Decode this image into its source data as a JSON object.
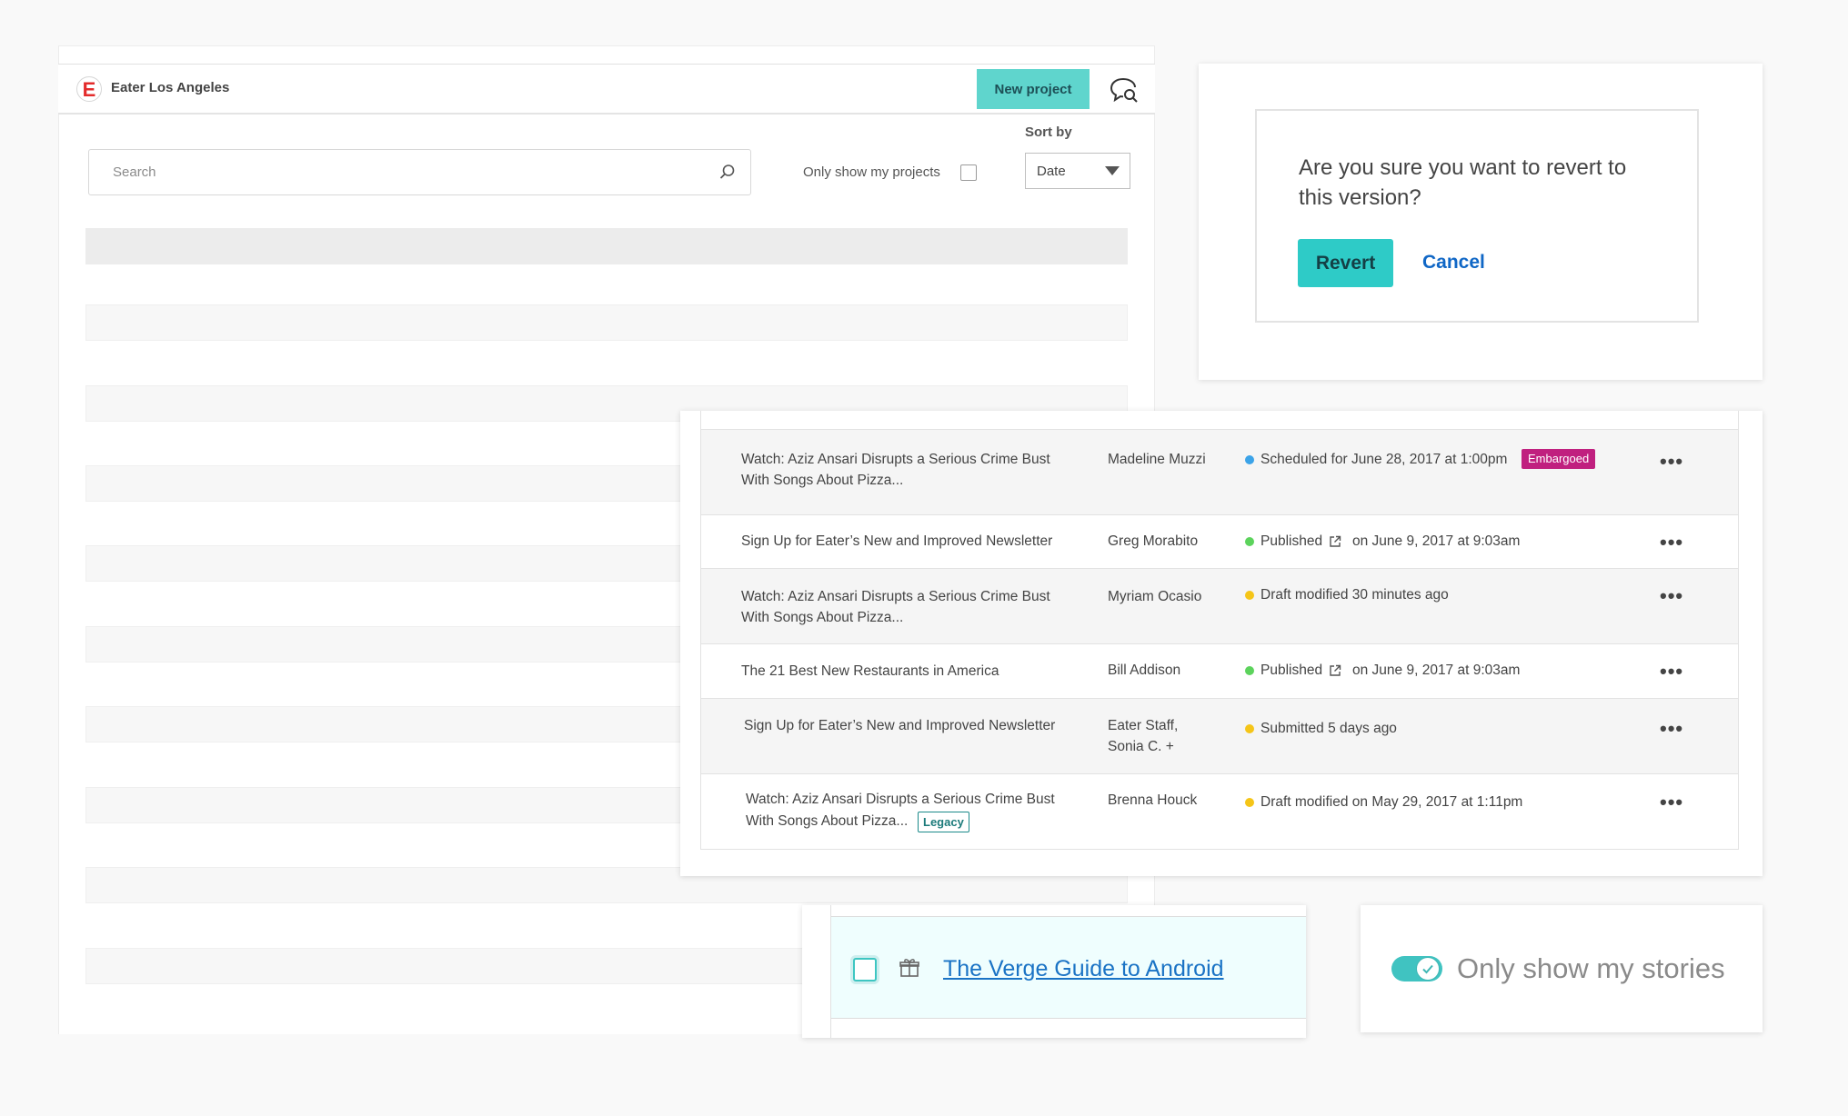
{
  "header": {
    "site_name": "Eater Los Angeles",
    "logo_letter": "E",
    "new_project_label": "New project"
  },
  "filters": {
    "search_placeholder": "Search",
    "only_show_my_projects_label": "Only show my projects",
    "only_show_my_projects_checked": false,
    "sort_by_label": "Sort by",
    "sort_selected": "Date"
  },
  "revert_dialog": {
    "question": "Are you sure you want to revert to this version?",
    "confirm_label": "Revert",
    "cancel_label": "Cancel"
  },
  "stories": [
    {
      "title": "Watch: Aziz Ansari Disrupts a Serious Crime Bust With Songs About Pizza...",
      "author": "Madeline Muzzi",
      "status_color": "#3ba3e8",
      "status_text": "Scheduled for June 28, 2017 at 1:00pm",
      "badge": "Embargoed"
    },
    {
      "title": "Sign Up for Eater’s New and Improved Newsletter",
      "author": "Greg Morabito",
      "status_color": "#5cd35c",
      "status_text": "Published",
      "status_suffix": "on June 9, 2017 at 9:03am"
    },
    {
      "title": "Watch: Aziz Ansari Disrupts a Serious Crime Bust With Songs About Pizza...",
      "author": "Myriam Ocasio",
      "status_color": "#f5c518",
      "status_text": "Draft modified 30 minutes ago"
    },
    {
      "title": "The 21 Best New Restaurants in America",
      "author": "Bill Addison",
      "status_color": "#5cd35c",
      "status_text": "Published",
      "status_suffix": "on June 9, 2017 at 9:03am"
    },
    {
      "title": "Sign Up for Eater’s New and Improved Newsletter",
      "author_line1": "Eater Staff,",
      "author_line2": "Sonia C. +",
      "status_color": "#f5c518",
      "status_text": "Submitted 5 days ago"
    },
    {
      "title_line1": "Watch: Aziz Ansari Disrupts a Serious Crime Bust",
      "title_line2": "With Songs About Pizza...",
      "author": "Brenna Houck",
      "status_color": "#f5c518",
      "status_text": "Draft modified on May 29, 2017 at 1:11pm",
      "badge": "Legacy"
    }
  ],
  "more_actions_glyph": "•••",
  "verge_card": {
    "link_text": "The Verge Guide to Android",
    "icon": "gift-icon"
  },
  "toggle_card": {
    "label": "Only show my stories",
    "checked": true
  },
  "colors": {
    "accent": "#2ecbc7",
    "link": "#1067c6",
    "embargo": "#c0207f",
    "legacy": "#1b7a7a"
  }
}
